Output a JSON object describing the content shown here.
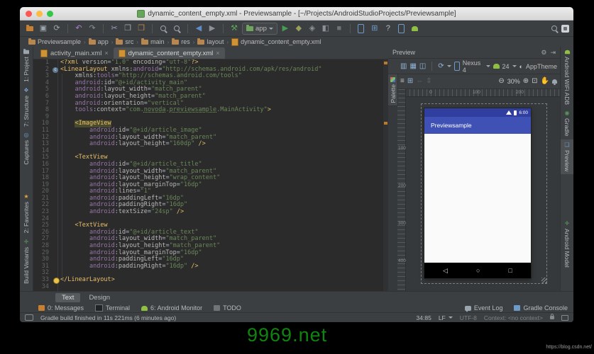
{
  "titlebar": {
    "title": "dynamic_content_empty.xml - Previewsample - [~/Projects/AndroidStudioProjects/Previewsample]"
  },
  "toolbar": {
    "app_label": "app",
    "items": [
      {
        "name": "open-project-icon",
        "kind": "folder",
        "color": "#c77f31"
      },
      {
        "name": "save-all-icon",
        "glyph": "▣",
        "color": "#9aa5ad"
      },
      {
        "name": "sync-icon",
        "glyph": "⟳",
        "color": "#9aa5ad"
      },
      {
        "kind": "sep"
      },
      {
        "name": "undo-icon",
        "glyph": "↶",
        "color": "#b07ec9"
      },
      {
        "name": "redo-icon",
        "glyph": "↷",
        "color": "#8a9298"
      },
      {
        "kind": "sep"
      },
      {
        "name": "cut-icon",
        "glyph": "✂",
        "color": "#a59cc0"
      },
      {
        "name": "copy-icon",
        "glyph": "❐",
        "color": "#9aa5ad"
      },
      {
        "name": "paste-icon",
        "glyph": "❒",
        "color": "#b9854f"
      },
      {
        "kind": "sep"
      },
      {
        "name": "find-icon",
        "kind": "mag"
      },
      {
        "name": "replace-icon",
        "kind": "mag"
      },
      {
        "kind": "sep"
      },
      {
        "name": "back-icon",
        "glyph": "◀",
        "color": "#5f8cc9"
      },
      {
        "name": "forward-icon",
        "glyph": "▶",
        "color": "#8a9298"
      },
      {
        "kind": "sep"
      },
      {
        "name": "make-project-icon",
        "glyph": "⚒",
        "color": "#58a55c"
      },
      {
        "name": "run-config-chip",
        "kind": "chip"
      },
      {
        "name": "run-icon",
        "glyph": "▶",
        "color": "#499c54"
      },
      {
        "name": "debug-icon",
        "glyph": "◆",
        "color": "#97a05a"
      },
      {
        "name": "coverage-icon",
        "glyph": "◈",
        "color": "#8a9298"
      },
      {
        "name": "profile-icon",
        "glyph": "◧",
        "color": "#8a9298"
      },
      {
        "name": "stop-icon",
        "glyph": "■",
        "color": "#6d7276"
      },
      {
        "kind": "sep"
      },
      {
        "name": "avd-manager-icon",
        "kind": "phone"
      },
      {
        "name": "sdk-manager-icon",
        "glyph": "⊞",
        "color": "#6f9ac6"
      },
      {
        "name": "help-icon",
        "glyph": "?",
        "color": "#b8bcbf"
      },
      {
        "name": "device-monitor-icon",
        "kind": "phone"
      },
      {
        "name": "android-device-monitor-icon",
        "kind": "droid"
      }
    ]
  },
  "breadcrumbs": {
    "items": [
      "Previewsample",
      "app",
      "src",
      "main",
      "res",
      "layout",
      "dynamic_content_empty.xml"
    ]
  },
  "left_strip": {
    "top": [
      {
        "name": "tool-button-project",
        "label": "1: Project",
        "icon": "folder"
      },
      {
        "name": "tool-button-structure",
        "label": "7: Structure",
        "icon": "❖",
        "color": "#7aa0c9"
      },
      {
        "name": "tool-button-captures",
        "label": "Captures",
        "icon": "◎",
        "color": "#6e9ac8"
      }
    ],
    "bottom": [
      {
        "name": "tool-button-favorites",
        "label": "2: Favorites",
        "icon": "★",
        "color": "#e0a53f"
      },
      {
        "name": "tool-button-build-variants",
        "label": "Build Variants",
        "icon": "✛",
        "color": "#5fa55f"
      }
    ]
  },
  "right_strip": {
    "top": [
      {
        "name": "tool-button-android-wifi-adb",
        "label": "Android WiFi ADB",
        "icon": "droid"
      },
      {
        "name": "tool-button-gradle",
        "label": "Gradle",
        "icon": "◉",
        "color": "#57965c"
      },
      {
        "name": "tool-button-preview",
        "label": "Preview",
        "icon": "❏",
        "color": "#6e9ac8",
        "active": true
      }
    ],
    "bottom": [
      {
        "name": "tool-button-android-model",
        "label": "Android Model",
        "icon": "✛",
        "color": "#5fa55f"
      }
    ]
  },
  "editor": {
    "tabs": [
      {
        "label": "activity_main.xml",
        "active": false
      },
      {
        "label": "dynamic_content_empty.xml",
        "active": true
      }
    ],
    "gutter_icons": {
      "2": "component-icon",
      "33": "intention-bulb-icon"
    },
    "lines": [
      {
        "n": 1,
        "s": [
          [
            "<?xml ",
            "t"
          ],
          [
            "version",
            "a"
          ],
          [
            "=",
            "p"
          ],
          [
            "\"1.0\"",
            "v"
          ],
          [
            " ",
            "p"
          ],
          [
            "encoding",
            "a"
          ],
          [
            "=",
            "p"
          ],
          [
            "\"utf-8\"",
            "v"
          ],
          [
            "?>",
            "t"
          ]
        ]
      },
      {
        "n": 2,
        "s": [
          [
            "<LinearLayout ",
            "t"
          ],
          [
            "xmlns:",
            "a"
          ],
          [
            "android",
            "n"
          ],
          [
            "=",
            "p"
          ],
          [
            "\"http://schemas.android.com/apk/res/android\"",
            "v"
          ]
        ]
      },
      {
        "n": 3,
        "s": [
          [
            "    ",
            "p"
          ],
          [
            "xmlns:",
            "a"
          ],
          [
            "tools",
            "n"
          ],
          [
            "=",
            "p"
          ],
          [
            "\"http://schemas.android.com/tools\"",
            "v"
          ]
        ]
      },
      {
        "n": 4,
        "s": [
          [
            "    ",
            "p"
          ],
          [
            "android",
            "n"
          ],
          [
            ":",
            "p"
          ],
          [
            "id",
            "a"
          ],
          [
            "=",
            "p"
          ],
          [
            "\"@+id/activity_main\"",
            "v"
          ]
        ]
      },
      {
        "n": 5,
        "s": [
          [
            "    ",
            "p"
          ],
          [
            "android",
            "n"
          ],
          [
            ":",
            "p"
          ],
          [
            "layout_width",
            "a"
          ],
          [
            "=",
            "p"
          ],
          [
            "\"match_parent\"",
            "v"
          ]
        ]
      },
      {
        "n": 6,
        "s": [
          [
            "    ",
            "p"
          ],
          [
            "android",
            "n"
          ],
          [
            ":",
            "p"
          ],
          [
            "layout_height",
            "a"
          ],
          [
            "=",
            "p"
          ],
          [
            "\"match_parent\"",
            "v"
          ]
        ]
      },
      {
        "n": 7,
        "s": [
          [
            "    ",
            "p"
          ],
          [
            "android",
            "n"
          ],
          [
            ":",
            "p"
          ],
          [
            "orientation",
            "a"
          ],
          [
            "=",
            "p"
          ],
          [
            "\"vertical\"",
            "v"
          ]
        ]
      },
      {
        "n": 8,
        "s": [
          [
            "    ",
            "p"
          ],
          [
            "tools",
            "n"
          ],
          [
            ":",
            "p"
          ],
          [
            "context",
            "a"
          ],
          [
            "=",
            "p"
          ],
          [
            "\"com.",
            "v"
          ],
          [
            "novoda",
            "u"
          ],
          [
            ".",
            "v"
          ],
          [
            "previewsample",
            "u"
          ],
          [
            ".MainActivity\"",
            "v"
          ],
          [
            ">",
            "t"
          ]
        ]
      },
      {
        "n": 9,
        "s": []
      },
      {
        "n": 10,
        "s": [
          [
            "    ",
            "p"
          ],
          [
            "<ImageView",
            "h"
          ]
        ]
      },
      {
        "n": 11,
        "s": [
          [
            "        ",
            "p"
          ],
          [
            "android",
            "n"
          ],
          [
            ":",
            "p"
          ],
          [
            "id",
            "a"
          ],
          [
            "=",
            "p"
          ],
          [
            "\"@+id/article_image\"",
            "v"
          ]
        ]
      },
      {
        "n": 12,
        "s": [
          [
            "        ",
            "p"
          ],
          [
            "android",
            "n"
          ],
          [
            ":",
            "p"
          ],
          [
            "layout_width",
            "a"
          ],
          [
            "=",
            "p"
          ],
          [
            "\"match_parent\"",
            "v"
          ]
        ]
      },
      {
        "n": 13,
        "s": [
          [
            "        ",
            "p"
          ],
          [
            "android",
            "n"
          ],
          [
            ":",
            "p"
          ],
          [
            "layout_height",
            "a"
          ],
          [
            "=",
            "p"
          ],
          [
            "\"160dp\"",
            "v"
          ],
          [
            " />",
            "t"
          ]
        ]
      },
      {
        "n": 14,
        "s": []
      },
      {
        "n": 15,
        "s": [
          [
            "    ",
            "p"
          ],
          [
            "<TextView",
            "t"
          ]
        ]
      },
      {
        "n": 16,
        "s": [
          [
            "        ",
            "p"
          ],
          [
            "android",
            "n"
          ],
          [
            ":",
            "p"
          ],
          [
            "id",
            "a"
          ],
          [
            "=",
            "p"
          ],
          [
            "\"@+id/article_title\"",
            "v"
          ]
        ]
      },
      {
        "n": 17,
        "s": [
          [
            "        ",
            "p"
          ],
          [
            "android",
            "n"
          ],
          [
            ":",
            "p"
          ],
          [
            "layout_width",
            "a"
          ],
          [
            "=",
            "p"
          ],
          [
            "\"match_parent\"",
            "v"
          ]
        ]
      },
      {
        "n": 18,
        "s": [
          [
            "        ",
            "p"
          ],
          [
            "android",
            "n"
          ],
          [
            ":",
            "p"
          ],
          [
            "layout_height",
            "a"
          ],
          [
            "=",
            "p"
          ],
          [
            "\"wrap_content\"",
            "v"
          ]
        ]
      },
      {
        "n": 19,
        "s": [
          [
            "        ",
            "p"
          ],
          [
            "android",
            "n"
          ],
          [
            ":",
            "p"
          ],
          [
            "layout_marginTop",
            "a"
          ],
          [
            "=",
            "p"
          ],
          [
            "\"16dp\"",
            "v"
          ]
        ]
      },
      {
        "n": 20,
        "s": [
          [
            "        ",
            "p"
          ],
          [
            "android",
            "n"
          ],
          [
            ":",
            "p"
          ],
          [
            "lines",
            "a"
          ],
          [
            "=",
            "p"
          ],
          [
            "\"1\"",
            "v"
          ]
        ]
      },
      {
        "n": 21,
        "s": [
          [
            "        ",
            "p"
          ],
          [
            "android",
            "n"
          ],
          [
            ":",
            "p"
          ],
          [
            "paddingLeft",
            "a"
          ],
          [
            "=",
            "p"
          ],
          [
            "\"16dp\"",
            "v"
          ]
        ]
      },
      {
        "n": 22,
        "s": [
          [
            "        ",
            "p"
          ],
          [
            "android",
            "n"
          ],
          [
            ":",
            "p"
          ],
          [
            "paddingRight",
            "a"
          ],
          [
            "=",
            "p"
          ],
          [
            "\"16dp\"",
            "v"
          ]
        ]
      },
      {
        "n": 23,
        "s": [
          [
            "        ",
            "p"
          ],
          [
            "android",
            "n"
          ],
          [
            ":",
            "p"
          ],
          [
            "textSize",
            "a"
          ],
          [
            "=",
            "p"
          ],
          [
            "\"24sp\"",
            "v"
          ],
          [
            " />",
            "t"
          ]
        ]
      },
      {
        "n": 24,
        "s": []
      },
      {
        "n": 25,
        "s": [
          [
            "    ",
            "p"
          ],
          [
            "<TextView",
            "t"
          ]
        ]
      },
      {
        "n": 26,
        "s": [
          [
            "        ",
            "p"
          ],
          [
            "android",
            "n"
          ],
          [
            ":",
            "p"
          ],
          [
            "id",
            "a"
          ],
          [
            "=",
            "p"
          ],
          [
            "\"@+id/article_text\"",
            "v"
          ]
        ]
      },
      {
        "n": 27,
        "s": [
          [
            "        ",
            "p"
          ],
          [
            "android",
            "n"
          ],
          [
            ":",
            "p"
          ],
          [
            "layout_width",
            "a"
          ],
          [
            "=",
            "p"
          ],
          [
            "\"match_parent\"",
            "v"
          ]
        ]
      },
      {
        "n": 28,
        "s": [
          [
            "        ",
            "p"
          ],
          [
            "android",
            "n"
          ],
          [
            ":",
            "p"
          ],
          [
            "layout_height",
            "a"
          ],
          [
            "=",
            "p"
          ],
          [
            "\"match_parent\"",
            "v"
          ]
        ]
      },
      {
        "n": 29,
        "s": [
          [
            "        ",
            "p"
          ],
          [
            "android",
            "n"
          ],
          [
            ":",
            "p"
          ],
          [
            "layout_marginTop",
            "a"
          ],
          [
            "=",
            "p"
          ],
          [
            "\"16dp\"",
            "v"
          ]
        ]
      },
      {
        "n": 30,
        "s": [
          [
            "        ",
            "p"
          ],
          [
            "android",
            "n"
          ],
          [
            ":",
            "p"
          ],
          [
            "paddingLeft",
            "a"
          ],
          [
            "=",
            "p"
          ],
          [
            "\"16dp\"",
            "v"
          ]
        ]
      },
      {
        "n": 31,
        "s": [
          [
            "        ",
            "p"
          ],
          [
            "android",
            "n"
          ],
          [
            ":",
            "p"
          ],
          [
            "paddingRight",
            "a"
          ],
          [
            "=",
            "p"
          ],
          [
            "\"16dp\"",
            "v"
          ],
          [
            " />",
            "t"
          ]
        ]
      },
      {
        "n": 32,
        "s": []
      },
      {
        "n": 33,
        "s": [
          [
            "</LinearLayout>",
            "t"
          ]
        ]
      },
      {
        "n": 34,
        "s": []
      }
    ]
  },
  "preview": {
    "title": "Preview",
    "palette_label": "Palette",
    "device": "Nexus 4",
    "api": "24",
    "theme": "AppTheme",
    "zoom": "30%",
    "ruler_h": [
      "0",
      "100",
      "200"
    ],
    "ruler_v": [
      "100",
      "200",
      "300",
      "400"
    ],
    "screen": {
      "time": "6:00",
      "app_title": "Previewsample",
      "nav": {
        "back": "◁",
        "home": "○",
        "recents": "□"
      }
    }
  },
  "bottom_tabs": [
    {
      "label": "Text",
      "active": true
    },
    {
      "label": "Design",
      "active": false
    }
  ],
  "tool_buttons": {
    "left": [
      {
        "name": "messages-button",
        "label": "0: Messages",
        "icon": "msg"
      },
      {
        "name": "terminal-button",
        "label": "Terminal",
        "icon": "term"
      },
      {
        "name": "android-monitor-button",
        "label": "6: Android Monitor",
        "icon": "droid"
      },
      {
        "name": "todo-button",
        "label": "TODO",
        "icon": "todo"
      }
    ],
    "right": [
      {
        "name": "event-log-button",
        "label": "Event Log",
        "icon": "bubble"
      },
      {
        "name": "gradle-console-button",
        "label": "Gradle Console",
        "icon": "cons"
      }
    ]
  },
  "status_bar": {
    "message": "Gradle build finished in 11s 221ms (6 minutes ago)",
    "position": "34:85",
    "line_separator": "LF",
    "encoding": "UTF-8",
    "context": "Context: <no context>"
  },
  "watermark": {
    "text": "9969.net",
    "url": "https://blog.csdn.net/"
  }
}
